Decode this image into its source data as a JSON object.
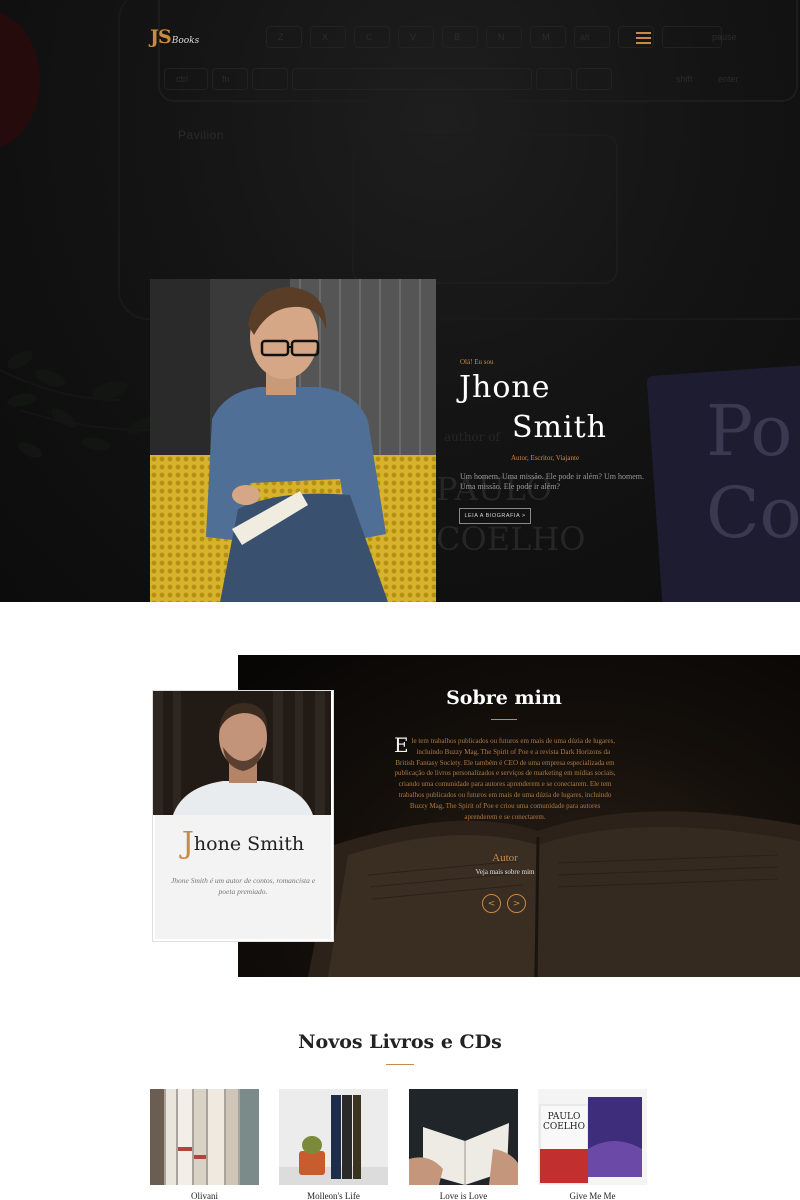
{
  "header": {
    "logo_initials": "JS",
    "logo_word": "Books",
    "menu_icon": "hamburger-menu-icon"
  },
  "hero": {
    "greeting": "Olá! Eu sou",
    "first_name": "Jhone",
    "last_name": "Smith",
    "roles": "Autor, Escritor, Viajante",
    "intro": "Um homem. Uma missão. Ele pode ir além? Um homem. Uma missão. Ele pode ir além?",
    "bio_button": "LEIA A BIOGRAFIA >"
  },
  "about": {
    "title": "Sobre mim",
    "dropcap": "E",
    "text": "le tem trabalhos publicados ou futuros em mais de uma dúzia de lugares, incluindo Buzzy Mag, The Spirit of Poe e a revista Dark Horizons da British Fantasy Society. Ele também é CEO de uma empresa especializada em publicação de livros personalizados e serviços de marketing em mídias sociais, criando uma comunidade para autores aprenderem e se conectarem. Ele tem trabalhos publicados ou futuros em mais de uma dúzia de lugares, incluindo Buzzy Mag, The Spirit of Poe e criou uma comunidade para autores aprenderem e se conectarem.",
    "role_label": "Autor",
    "see_more": "Veja mais sobre mim",
    "prev_label": "<",
    "next_label": ">",
    "card": {
      "name_initial": "J",
      "name_rest": "hone Smith",
      "description": "Jhone Smith é um autor de contos, romancista e poeta premiado."
    }
  },
  "books": {
    "title": "Novos Livros e CDs",
    "items": [
      {
        "name": "Olivani"
      },
      {
        "name": "Molleon's Life"
      },
      {
        "name": "Love is Love"
      },
      {
        "name": "Give Me Me"
      }
    ]
  },
  "background_text": {
    "laptop_brand": "Pavilion",
    "book_author_first": "PAULO",
    "book_author_last": "COELHO",
    "book_subtitle": "author of",
    "book_cover": "Po Co",
    "keys": [
      "Z",
      "X",
      "C",
      "V",
      "B",
      "N",
      "M",
      "alt",
      "ctrl",
      "fn",
      "pause",
      "shift",
      "enter"
    ]
  },
  "colors": {
    "accent": "#c98a48",
    "hero_bg": "#141414",
    "panel_bg": "#0c0907"
  }
}
